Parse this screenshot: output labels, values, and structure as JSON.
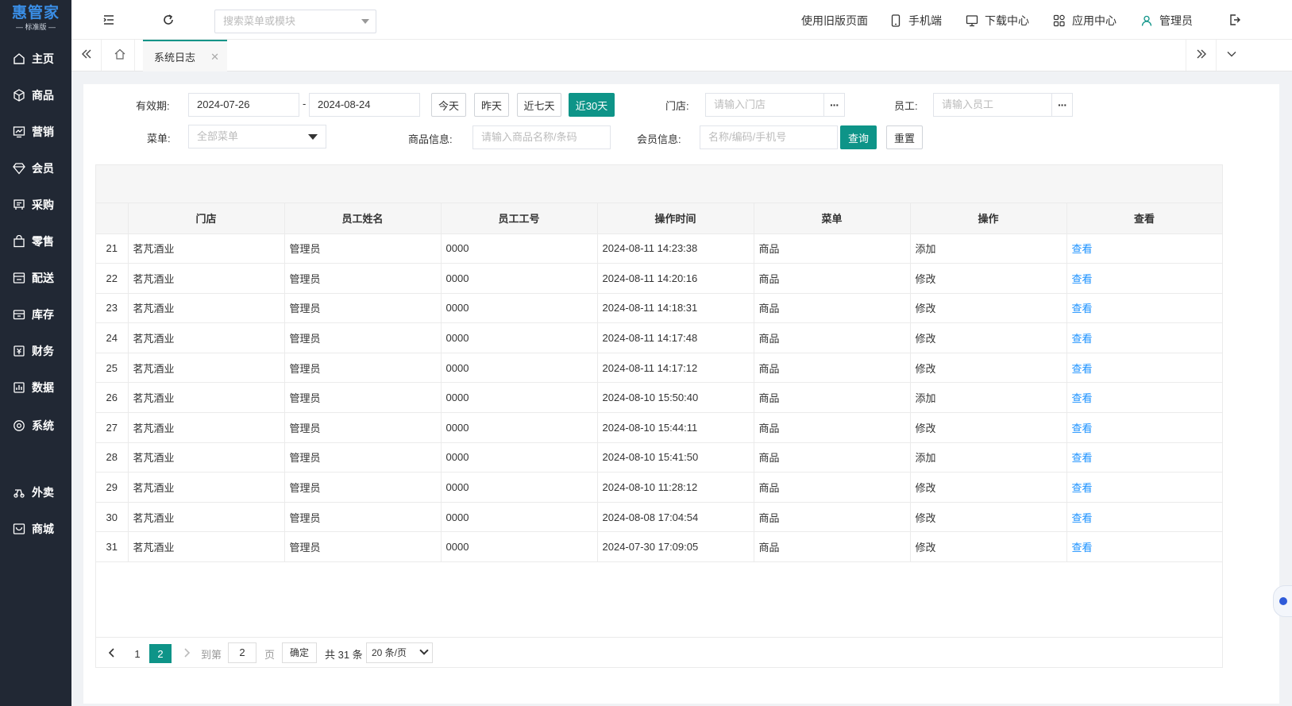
{
  "logo": {
    "main": "惠管家",
    "sub": "— 标准版 —"
  },
  "sidebar": {
    "items": [
      {
        "label": "主页",
        "icon": "home-icon"
      },
      {
        "label": "商品",
        "icon": "box-icon"
      },
      {
        "label": "营销",
        "icon": "chart-icon"
      },
      {
        "label": "会员",
        "icon": "diamond-icon"
      },
      {
        "label": "采购",
        "icon": "purchase-icon"
      },
      {
        "label": "零售",
        "icon": "bag-icon"
      },
      {
        "label": "配送",
        "icon": "delivery-icon"
      },
      {
        "label": "库存",
        "icon": "inventory-icon"
      },
      {
        "label": "财务",
        "icon": "finance-icon"
      },
      {
        "label": "数据",
        "icon": "data-icon"
      },
      {
        "label": "系统",
        "icon": "system-icon"
      },
      {
        "label": "外卖",
        "icon": "takeout-icon"
      },
      {
        "label": "商城",
        "icon": "mall-icon"
      }
    ]
  },
  "header": {
    "search_placeholder": "搜索菜单或模块",
    "links": [
      {
        "label": "使用旧版页面",
        "icon": ""
      },
      {
        "label": "手机端",
        "icon": "mobile-icon"
      },
      {
        "label": "下载中心",
        "icon": "monitor-icon"
      },
      {
        "label": "应用中心",
        "icon": "apps-icon"
      },
      {
        "label": "管理员",
        "icon": "user-icon"
      }
    ]
  },
  "tabs": {
    "active": "系统日志"
  },
  "filters": {
    "validity_label": "有效期:",
    "date_start": "2024-07-26",
    "date_sep": "-",
    "date_end": "2024-08-24",
    "quick": [
      "今天",
      "昨天",
      "近七天",
      "近30天"
    ],
    "quick_active_index": 3,
    "store_label": "门店:",
    "store_placeholder": "请输入门店",
    "staff_label": "员工:",
    "staff_placeholder": "请输入员工",
    "menu_label": "菜单:",
    "menu_value": "全部菜单",
    "goods_label": "商品信息:",
    "goods_placeholder": "请输入商品名称/条码",
    "member_label": "会员信息:",
    "member_placeholder": "名称/编码/手机号",
    "query_btn": "查询",
    "reset_btn": "重置",
    "more": "···"
  },
  "table": {
    "columns": [
      "门店",
      "员工姓名",
      "员工工号",
      "操作时间",
      "菜单",
      "操作",
      "查看"
    ],
    "rows": [
      {
        "no": "21",
        "store": "茗芃酒业",
        "name": "管理员",
        "code": "0000",
        "time": "2024-08-11 14:23:38",
        "menu": "商品",
        "op": "添加",
        "view": "查看"
      },
      {
        "no": "22",
        "store": "茗芃酒业",
        "name": "管理员",
        "code": "0000",
        "time": "2024-08-11 14:20:16",
        "menu": "商品",
        "op": "修改",
        "view": "查看"
      },
      {
        "no": "23",
        "store": "茗芃酒业",
        "name": "管理员",
        "code": "0000",
        "time": "2024-08-11 14:18:31",
        "menu": "商品",
        "op": "修改",
        "view": "查看"
      },
      {
        "no": "24",
        "store": "茗芃酒业",
        "name": "管理员",
        "code": "0000",
        "time": "2024-08-11 14:17:48",
        "menu": "商品",
        "op": "修改",
        "view": "查看"
      },
      {
        "no": "25",
        "store": "茗芃酒业",
        "name": "管理员",
        "code": "0000",
        "time": "2024-08-11 14:17:12",
        "menu": "商品",
        "op": "修改",
        "view": "查看"
      },
      {
        "no": "26",
        "store": "茗芃酒业",
        "name": "管理员",
        "code": "0000",
        "time": "2024-08-10 15:50:40",
        "menu": "商品",
        "op": "添加",
        "view": "查看"
      },
      {
        "no": "27",
        "store": "茗芃酒业",
        "name": "管理员",
        "code": "0000",
        "time": "2024-08-10 15:44:11",
        "menu": "商品",
        "op": "修改",
        "view": "查看"
      },
      {
        "no": "28",
        "store": "茗芃酒业",
        "name": "管理员",
        "code": "0000",
        "time": "2024-08-10 15:41:50",
        "menu": "商品",
        "op": "添加",
        "view": "查看"
      },
      {
        "no": "29",
        "store": "茗芃酒业",
        "name": "管理员",
        "code": "0000",
        "time": "2024-08-10 11:28:12",
        "menu": "商品",
        "op": "修改",
        "view": "查看"
      },
      {
        "no": "30",
        "store": "茗芃酒业",
        "name": "管理员",
        "code": "0000",
        "time": "2024-08-08 17:04:54",
        "menu": "商品",
        "op": "修改",
        "view": "查看"
      },
      {
        "no": "31",
        "store": "茗芃酒业",
        "name": "管理员",
        "code": "0000",
        "time": "2024-07-30 17:09:05",
        "menu": "商品",
        "op": "修改",
        "view": "查看"
      }
    ]
  },
  "pagination": {
    "pages": [
      "1",
      "2"
    ],
    "current": "2",
    "goto_label": "到第",
    "goto_value": "2",
    "page_unit": "页",
    "confirm": "确定",
    "total": "共 31 条",
    "page_size": "20 条/页"
  },
  "colors": {
    "accent": "#0e9488",
    "sidebar": "#212834",
    "link": "#1890ff"
  }
}
